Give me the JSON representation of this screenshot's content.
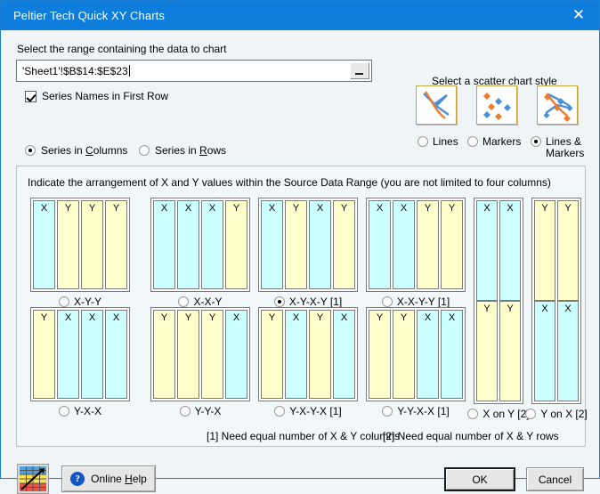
{
  "window": {
    "title": "Peltier Tech Quick XY Charts",
    "close_icon": "close-icon",
    "accent_color": "#0f7ddb"
  },
  "range_section": {
    "label": "Select the range containing the data to chart",
    "value": "'Sheet1'!$B$14:$E$23",
    "placeholder": "",
    "picker_icon": "range-collapse-icon",
    "checkbox": {
      "label": "Series Names in First Row",
      "checked": true
    },
    "orientation": {
      "options": [
        {
          "label_pre": "Series in ",
          "accel": "C",
          "label_post": "olumns",
          "selected": true
        },
        {
          "label_pre": "Series in ",
          "accel": "R",
          "label_post": "ows",
          "selected": false
        }
      ]
    }
  },
  "style_section": {
    "label": "Select a scatter chart style",
    "options": [
      {
        "label": "Lines",
        "icon": "lines-chart-icon",
        "selected": false
      },
      {
        "label": "Markers",
        "icon": "markers-chart-icon",
        "selected": false
      },
      {
        "label": "Lines & Markers",
        "icon": "lines-markers-chart-icon",
        "selected": true
      }
    ],
    "series_colors": {
      "orange": "#ed7d31",
      "blue": "#4a90d9"
    }
  },
  "arrangement_section": {
    "label": "Indicate the arrangement of X and Y values within the Source Data Range (you are not limited to four columns)",
    "colors": {
      "x": "#ccffff",
      "y": "#ffffcc"
    },
    "patterns": [
      {
        "id": "x-y-y",
        "label": "X-Y-Y",
        "layout": "columns",
        "cells": [
          "X",
          "Y",
          "Y",
          "Y"
        ],
        "selected": false
      },
      {
        "id": "x-x-y",
        "label": "X-X-Y",
        "layout": "columns",
        "cells": [
          "X",
          "X",
          "X",
          "Y"
        ],
        "selected": false
      },
      {
        "id": "x-y-x-y",
        "label": "X-Y-X-Y [1]",
        "layout": "columns",
        "cells": [
          "X",
          "Y",
          "X",
          "Y"
        ],
        "selected": true
      },
      {
        "id": "x-x-y-y",
        "label": "X-X-Y-Y [1]",
        "layout": "columns",
        "cells": [
          "X",
          "X",
          "Y",
          "Y"
        ],
        "selected": false
      },
      {
        "id": "x-on-y",
        "label": "X on Y [2]",
        "layout": "stacked",
        "top": [
          "X",
          "X"
        ],
        "bottom": [
          "Y",
          "Y"
        ],
        "selected": false
      },
      {
        "id": "y-on-x",
        "label": "Y on X [2]",
        "layout": "stacked",
        "top": [
          "Y",
          "Y"
        ],
        "bottom": [
          "X",
          "X"
        ],
        "selected": false
      },
      {
        "id": "y-x-x",
        "label": "Y-X-X",
        "layout": "columns",
        "cells": [
          "Y",
          "X",
          "X",
          "X"
        ],
        "selected": false
      },
      {
        "id": "y-y-x",
        "label": "Y-Y-X",
        "layout": "columns",
        "cells": [
          "Y",
          "Y",
          "Y",
          "X"
        ],
        "selected": false
      },
      {
        "id": "y-x-y-x",
        "label": "Y-X-Y-X [1]",
        "layout": "columns",
        "cells": [
          "Y",
          "X",
          "Y",
          "X"
        ],
        "selected": false
      },
      {
        "id": "y-y-x-x",
        "label": "Y-Y-X-X [1]",
        "layout": "columns",
        "cells": [
          "Y",
          "Y",
          "X",
          "X"
        ],
        "selected": false
      }
    ],
    "footnotes": [
      "[1] Need equal number of X & Y columns",
      "[2] Need equal number of X & Y rows"
    ]
  },
  "footer": {
    "logo_icon": "peltier-tech-logo-icon",
    "help": {
      "label_pre": "Online ",
      "accel": "H",
      "label_post": "elp",
      "icon": "question-mark-icon"
    },
    "ok_label": "OK",
    "cancel_label": "Cancel"
  }
}
